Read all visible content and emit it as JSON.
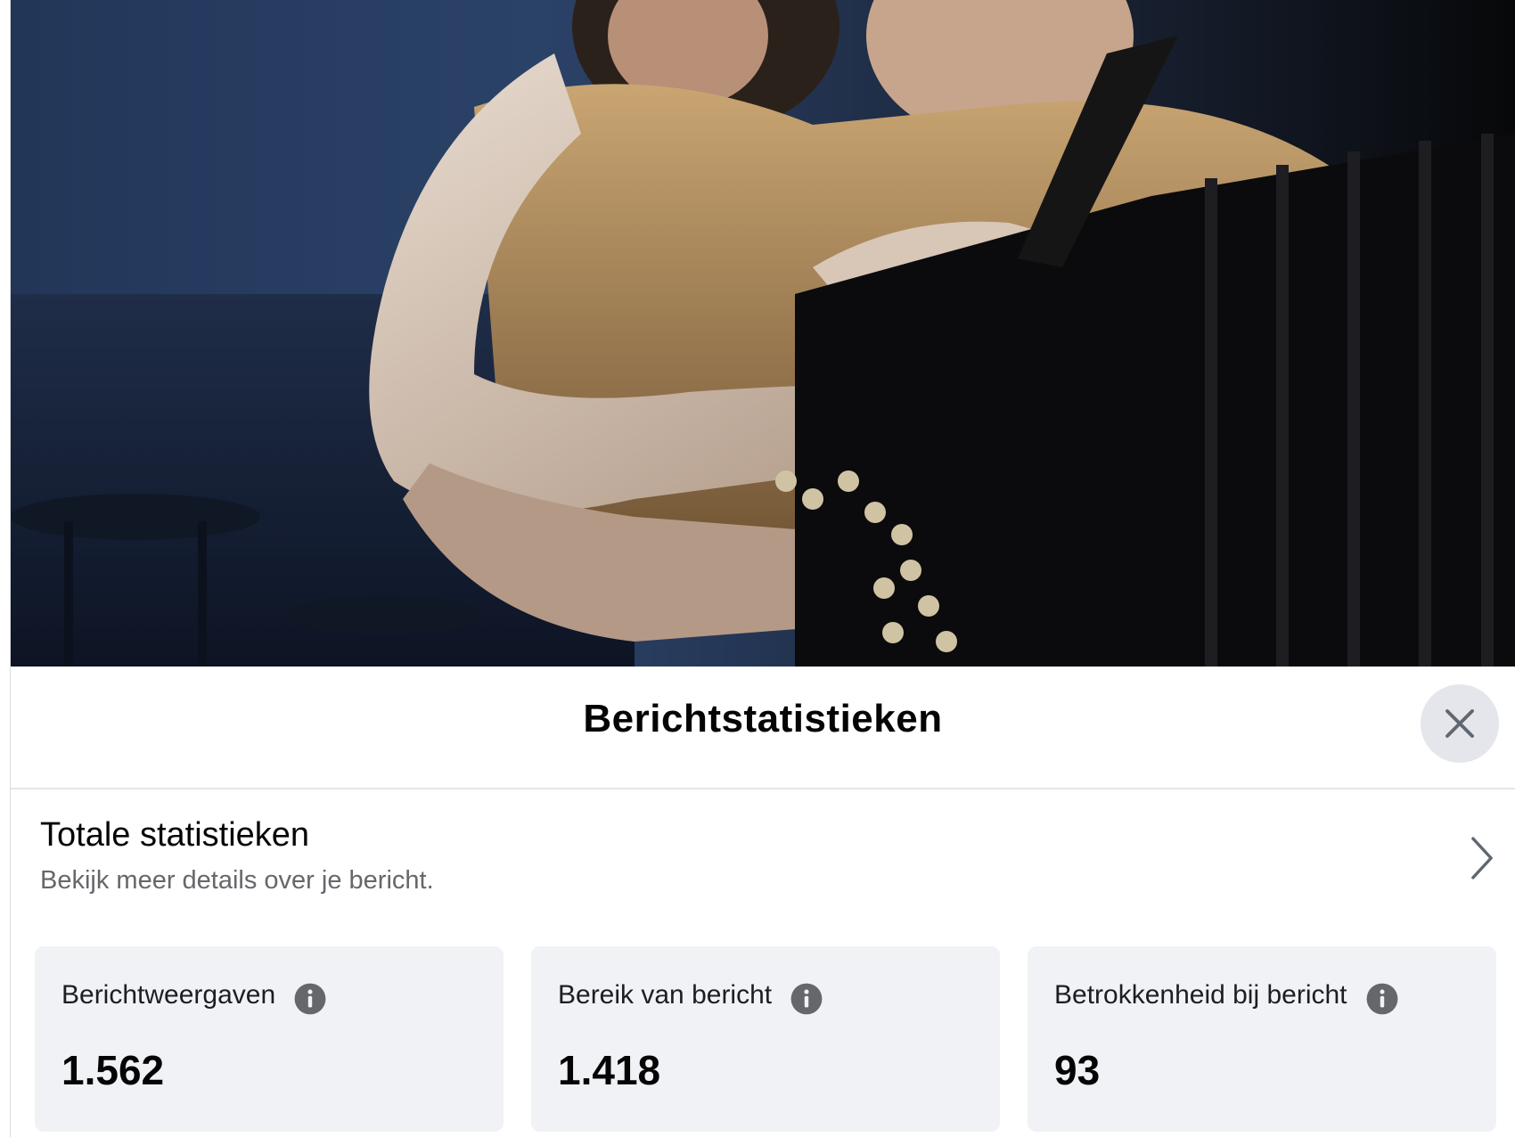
{
  "modal": {
    "title": "Berichtstatistieken",
    "close_icon": "close-icon"
  },
  "totals": {
    "title": "Totale statistieken",
    "subtitle": "Bekijk meer details over je bericht.",
    "chevron_icon": "chevron-right-icon"
  },
  "stats": [
    {
      "label": "Berichtweergaven",
      "value": "1.562",
      "icon": "info-icon"
    },
    {
      "label": "Bereik van bericht",
      "value": "1.418",
      "icon": "info-icon"
    },
    {
      "label": "Betrokkenheid bij bericht",
      "value": "93",
      "icon": "info-icon"
    }
  ],
  "colors": {
    "card_background": "#f0f2f5",
    "close_button_background": "#e4e6eb",
    "secondary_text": "#65676b",
    "icon_gray": "#65676b"
  }
}
